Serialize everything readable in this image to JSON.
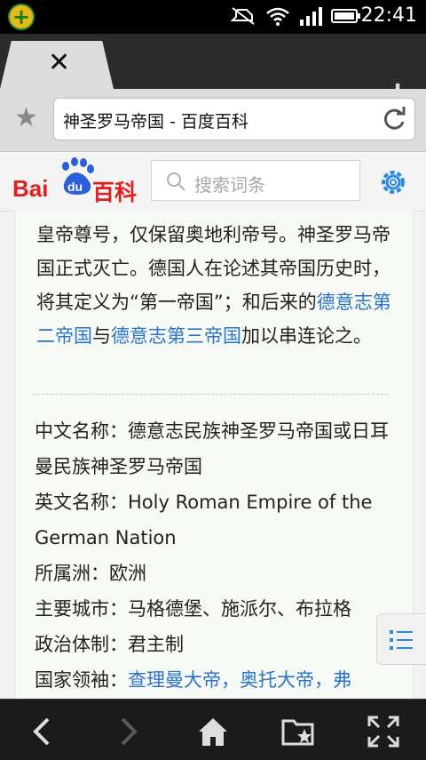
{
  "status_bar": {
    "time": "22:41",
    "app_icon": "plus-badge-icon",
    "icons": [
      "silent-mode-icon",
      "wifi-icon",
      "signal-icon",
      "battery-icon"
    ]
  },
  "tab": {
    "close_icon": "close-icon",
    "new_tab_icon": "plus-icon"
  },
  "address_bar": {
    "url_text": "神圣罗马帝国 - 百度百科",
    "bookmark_icon": "star-icon",
    "reload_icon": "reload-icon"
  },
  "baidu_header": {
    "logo_text_a": "Bai",
    "logo_text_b": "du",
    "logo_text_c": "百科",
    "search_placeholder": "搜索词条",
    "settings_icon": "gear-icon"
  },
  "article": {
    "para_line1": "皇帝尊号，仅保留奥地利帝号。神圣罗马帝国正式灭亡。德国人在论述其帝国历史时，将其定义为“第一帝国”；和后来的",
    "link_second_reich": "德意志第二帝国",
    "para_mid": "与",
    "link_third_reich": "德意志第三帝国",
    "para_end": "加以串连论之。"
  },
  "infobox": {
    "chinese_name_label": "中文名称：",
    "chinese_name_value": "德意志民族神圣罗马帝国或日耳曼民族神圣罗马帝国",
    "english_name_label": "英文名称：",
    "english_name_value": "Holy Roman Empire of the German Nation",
    "continent_label": "所属洲：",
    "continent_value": "欧洲",
    "cities_label": "主要城市：",
    "cities_value": "马格德堡、施派尔、布拉格",
    "government_label": "政治体制：",
    "government_value": "君主制",
    "leaders_label": "国家领袖：",
    "leader_1": "查理曼大帝",
    "sep1": "，",
    "leader_2": "奥托大帝",
    "sep2": "，",
    "leader_3": "弗"
  },
  "toc_button": {
    "icon": "list-icon"
  },
  "bottom_bar": {
    "icons": [
      "back-icon",
      "forward-icon",
      "home-icon",
      "bookmarks-folder-icon",
      "fullscreen-icon"
    ]
  },
  "colors": {
    "link": "#2a74c8",
    "baidu_red": "#e02020",
    "baidu_blue": "#2b5fd9",
    "accent_blue": "#2a8ae0"
  }
}
